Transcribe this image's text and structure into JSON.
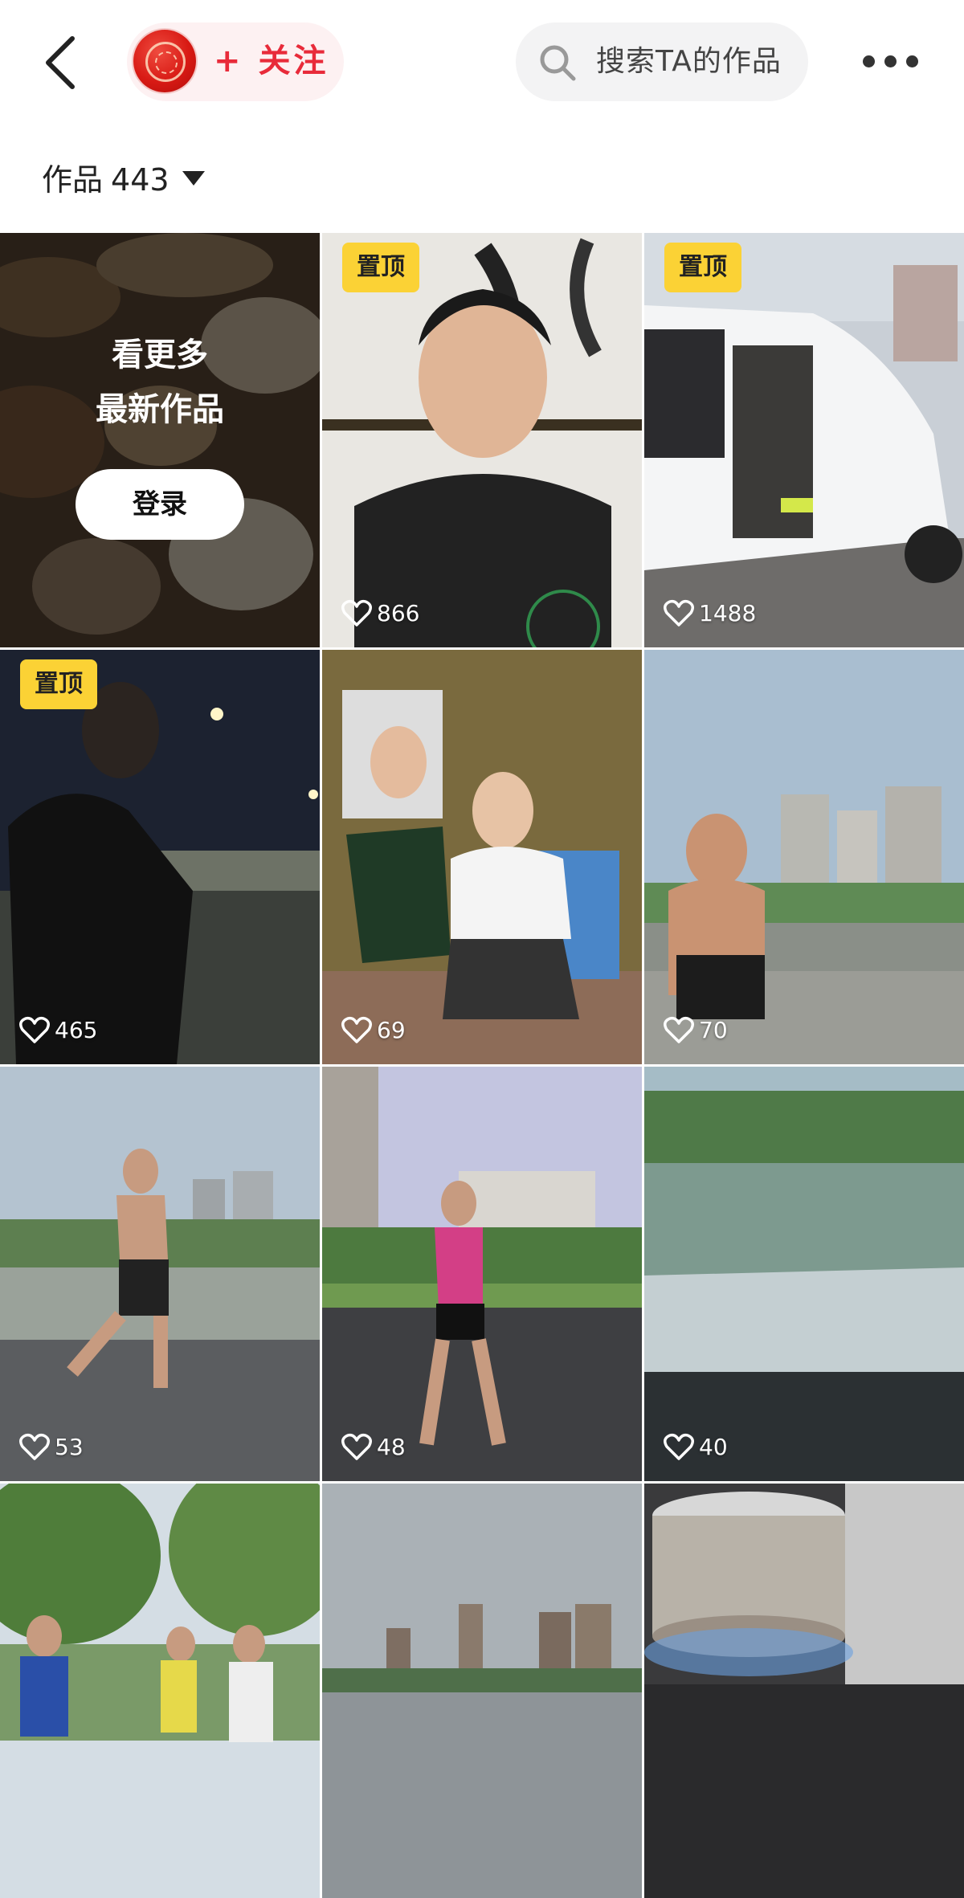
{
  "header": {
    "follow_label": "+ 关注",
    "search_placeholder": "搜索TA的作品"
  },
  "works": {
    "label": "作品",
    "count": "443"
  },
  "login_card": {
    "line1": "看更多",
    "line2": "最新作品",
    "button_label": "登录"
  },
  "pin_label": "置顶",
  "videos": [
    {
      "pinned": true,
      "likes": "866",
      "scene": "portrait"
    },
    {
      "pinned": true,
      "likes": "1488",
      "scene": "van"
    },
    {
      "pinned": true,
      "likes": "465",
      "scene": "night-run"
    },
    {
      "pinned": false,
      "likes": "69",
      "scene": "jersey"
    },
    {
      "pinned": false,
      "likes": "70",
      "scene": "riverside"
    },
    {
      "pinned": false,
      "likes": "53",
      "scene": "river-run"
    },
    {
      "pinned": false,
      "likes": "48",
      "scene": "park-run"
    },
    {
      "pinned": false,
      "likes": "40",
      "scene": "flood"
    },
    {
      "pinned": false,
      "likes": "",
      "scene": "trees-runners"
    },
    {
      "pinned": false,
      "likes": "",
      "scene": "city-river"
    },
    {
      "pinned": false,
      "likes": "",
      "scene": "pot"
    }
  ],
  "colors": {
    "accent": "#e82b3a",
    "pin_badge": "#fbd235"
  }
}
